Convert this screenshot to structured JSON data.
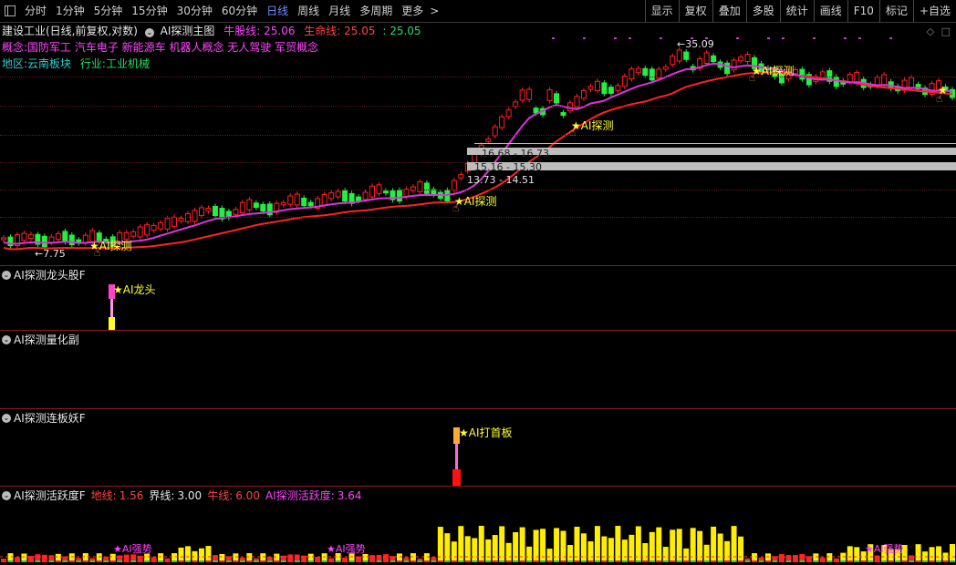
{
  "topbar": {
    "periods": [
      {
        "label": "分时",
        "active": false
      },
      {
        "label": "1分钟",
        "active": false
      },
      {
        "label": "5分钟",
        "active": false
      },
      {
        "label": "15分钟",
        "active": false
      },
      {
        "label": "30分钟",
        "active": false
      },
      {
        "label": "60分钟",
        "active": false
      },
      {
        "label": "日线",
        "active": true
      },
      {
        "label": "周线",
        "active": false
      },
      {
        "label": "月线",
        "active": false
      },
      {
        "label": "多周期",
        "active": false
      },
      {
        "label": "更多",
        "active": false
      }
    ],
    "more_arrow": ">",
    "right_buttons": [
      "显示",
      "复权",
      "叠加",
      "多股",
      "统计",
      "画线",
      "F10",
      "标记",
      "+自选"
    ]
  },
  "main": {
    "stock_title": "建设工业(日线,前复权,对数)",
    "indicator_name": "AI探测主图",
    "bull_label": "牛股线:",
    "bull_value": "25.06",
    "life_label": "生命线:",
    "life_value": "25.05",
    "extra_value": ": 25.05",
    "concept_label": "概念:",
    "concepts": "国防军工 汽车电子 新能源车 机器人概念 无人驾驶 军贸概念",
    "region_label": "地区:",
    "region_value": "云南板块",
    "industry_label": "行业:",
    "industry_value": "工业机械",
    "high_label": "35.09",
    "low_label": "7.75",
    "gap_labels": [
      "16.68 - 16.73",
      "15.16 - 15.30",
      "13.73 - 14.51"
    ],
    "signal_label": "AI探测",
    "colors": {
      "up": "#ff2222",
      "down": "#22ee44",
      "bull": "#dd33dd",
      "life": "#ff2222"
    }
  },
  "panel_dragon": {
    "title": "AI探测龙头股F",
    "signal": "AI龙头"
  },
  "panel_quant": {
    "title": "AI探测量化副"
  },
  "panel_board": {
    "title": "AI探测连板妖F",
    "signal": "AI打首板"
  },
  "panel_active": {
    "title": "AI探测活跃度F",
    "ground_label": "地线:",
    "ground_value": "1.56",
    "bound_label": "界线:",
    "bound_value": "3.00",
    "cow_label": "牛线:",
    "cow_value": "6.00",
    "active_label": "AI探测活跃度:",
    "active_value": "3.64",
    "signal": "AI强势"
  }
}
